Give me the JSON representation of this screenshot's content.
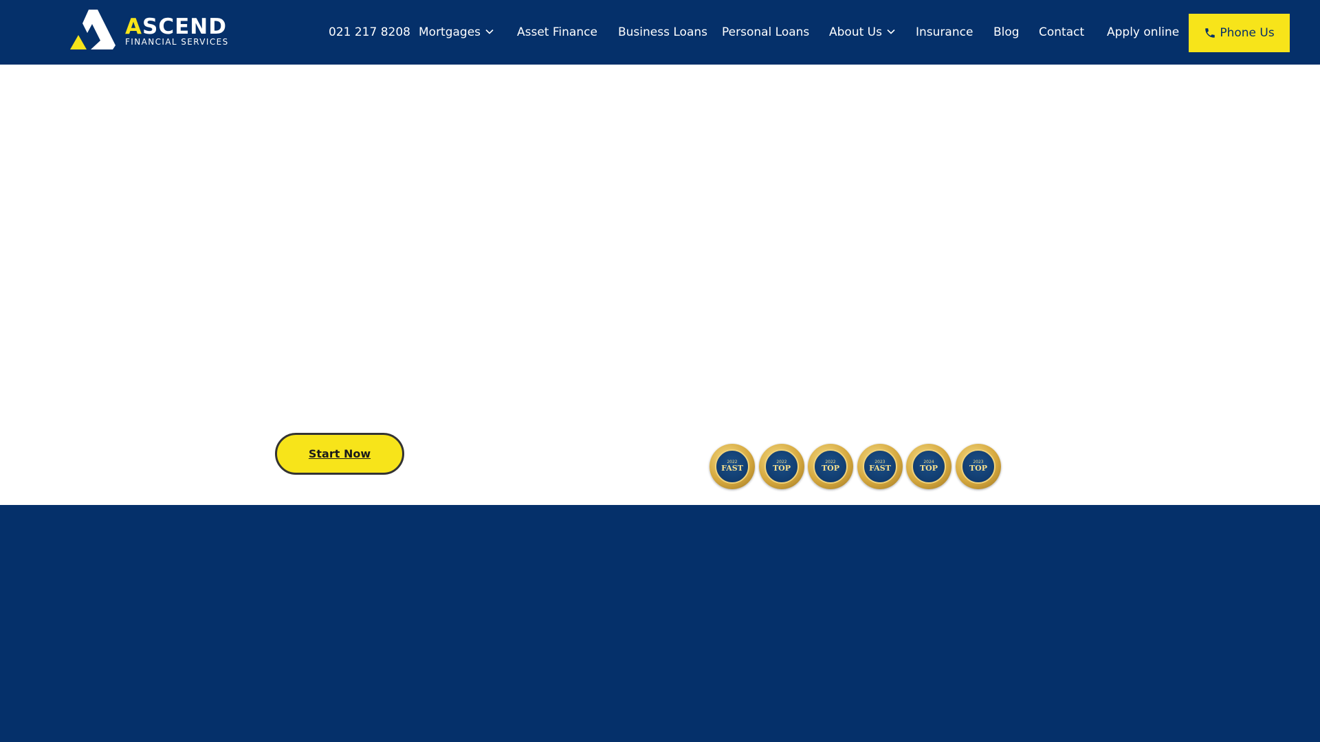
{
  "brand": {
    "name_first": "A",
    "name_rest": "SCEND",
    "tagline": "FINANCIAL SERVICES",
    "colors": {
      "navy": "#05306a",
      "yellow": "#f7e41a",
      "white": "#ffffff"
    }
  },
  "nav": {
    "phone_number": "021 217 8208",
    "items": [
      {
        "label": "Mortgages",
        "has_dropdown": true
      },
      {
        "label": "Asset Finance",
        "has_dropdown": false
      },
      {
        "label": "Business Loans",
        "has_dropdown": false
      },
      {
        "label": "Personal Loans",
        "has_dropdown": false
      },
      {
        "label": "About Us",
        "has_dropdown": true
      },
      {
        "label": "Insurance",
        "has_dropdown": false
      },
      {
        "label": "Blog",
        "has_dropdown": false
      },
      {
        "label": "Contact",
        "has_dropdown": false
      },
      {
        "label": "Apply online",
        "has_dropdown": false
      }
    ],
    "cta_label": "Phone Us",
    "cta_icon": "phone-icon"
  },
  "hero": {
    "start_button": "Start Now"
  },
  "awards": [
    {
      "year": "2022",
      "word": "FAST"
    },
    {
      "year": "2022",
      "word": "TOP"
    },
    {
      "year": "2022",
      "word": "TOP"
    },
    {
      "year": "2023",
      "word": "FAST"
    },
    {
      "year": "2024",
      "word": "TOP"
    },
    {
      "year": "2023",
      "word": "TOP"
    }
  ]
}
